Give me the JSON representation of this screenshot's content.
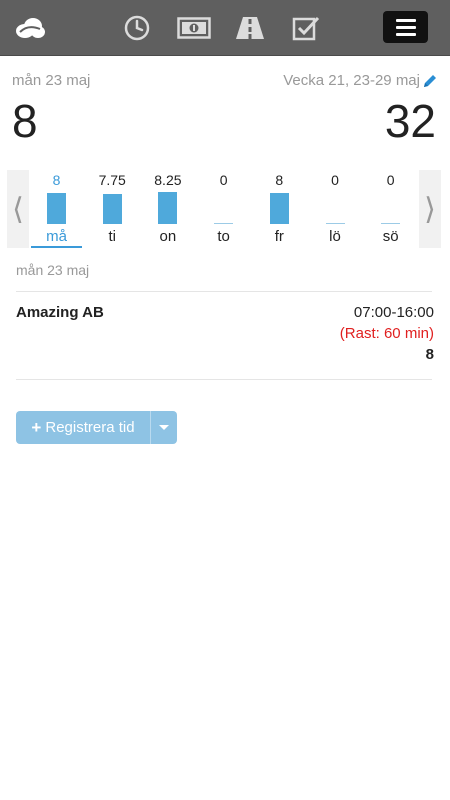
{
  "nav": {
    "logo_icon": "cloud-logo-icon",
    "icons": [
      "clock-icon",
      "money-icon",
      "road-icon",
      "checkbox-icon"
    ],
    "menu_icon": "hamburger-icon",
    "bar_color": "#5f5f5f"
  },
  "header": {
    "date": "mån 23 maj",
    "week": "Vecka 21, 23-29 maj",
    "day_total": "8",
    "week_total": "32"
  },
  "chart_data": {
    "type": "bar",
    "categories": [
      "må",
      "ti",
      "on",
      "to",
      "fr",
      "lö",
      "sö"
    ],
    "values": [
      8,
      7.75,
      8.25,
      0,
      8,
      0,
      0
    ],
    "value_labels": [
      "8",
      "7.75",
      "8.25",
      "0",
      "8",
      "0",
      "0"
    ],
    "selected_index": 0,
    "nav_prev": "⟨",
    "nav_next": "⟩",
    "bar_color": "#4fa9db",
    "accent_color": "#3a9ad9"
  },
  "day_section": {
    "date": "mån 23 maj"
  },
  "entries": [
    {
      "company": "Amazing AB",
      "time": "07:00-16:00",
      "break": "(Rast: 60 min)",
      "hours": "8"
    }
  ],
  "actions": {
    "register_label": "Registrera tid",
    "register_plus": "+",
    "button_color": "#8ec3e4"
  }
}
